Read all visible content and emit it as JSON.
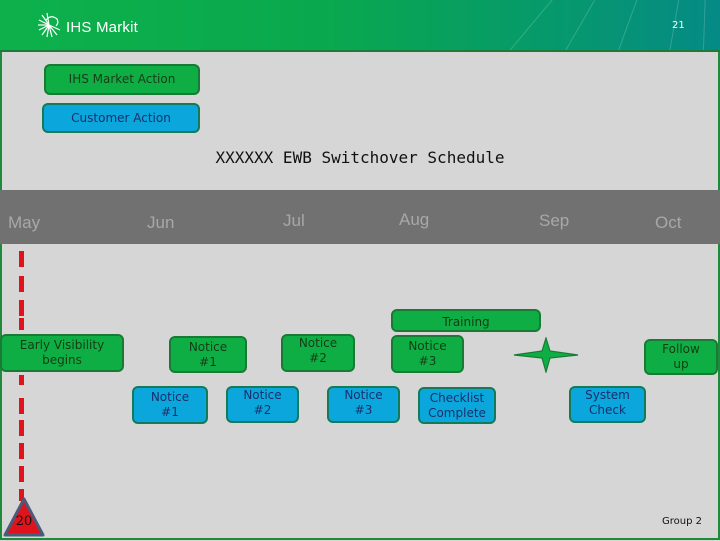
{
  "header": {
    "logo_text": "IHS Markit",
    "page_number": "21",
    "logo_icon": "ihs-markit-sunburst-icon"
  },
  "legend": {
    "ihs_action": "IHS Market Action",
    "customer_action": "Customer Action"
  },
  "title": "XXXXXX EWB Switchover Schedule",
  "months": [
    "May",
    "Jun",
    "Jul",
    "Aug",
    "Sep",
    "Oct"
  ],
  "ihs_items": [
    {
      "label": "Early Visibility begins",
      "line1": "Early Visibility",
      "line2": "begins"
    },
    {
      "label": "Notice #1",
      "line1": "Notice",
      "line2": "#1"
    },
    {
      "label": "Notice #2",
      "line1": "Notice",
      "line2": "#2"
    },
    {
      "label": "Training",
      "line1": "Training",
      "line2": ""
    },
    {
      "label": "Notice #3",
      "line1": "Notice",
      "line2": "#3"
    },
    {
      "label": "Follow up",
      "line1": "Follow",
      "line2": "up"
    }
  ],
  "customer_items": [
    {
      "label": "Notice #1",
      "line1": "Notice",
      "line2": "#1"
    },
    {
      "label": "Notice #2",
      "line1": "Notice",
      "line2": "#2"
    },
    {
      "label": "Notice #3",
      "line1": "Notice",
      "line2": "#3"
    },
    {
      "label": "Checklist Complete",
      "line1": "Checklist",
      "line2": "Complete"
    },
    {
      "label": "System Check",
      "line1": "System",
      "line2": "Check"
    }
  ],
  "milestone": {
    "icon": "four-point-star-icon"
  },
  "today_marker": {
    "label": "20",
    "icon": "warning-triangle-icon"
  },
  "footer": "Group 2",
  "colors": {
    "ihs_green": "#0fae45",
    "customer_blue": "#0aa6dc",
    "marker_red": "#e0121c",
    "month_bar": "#717171"
  }
}
